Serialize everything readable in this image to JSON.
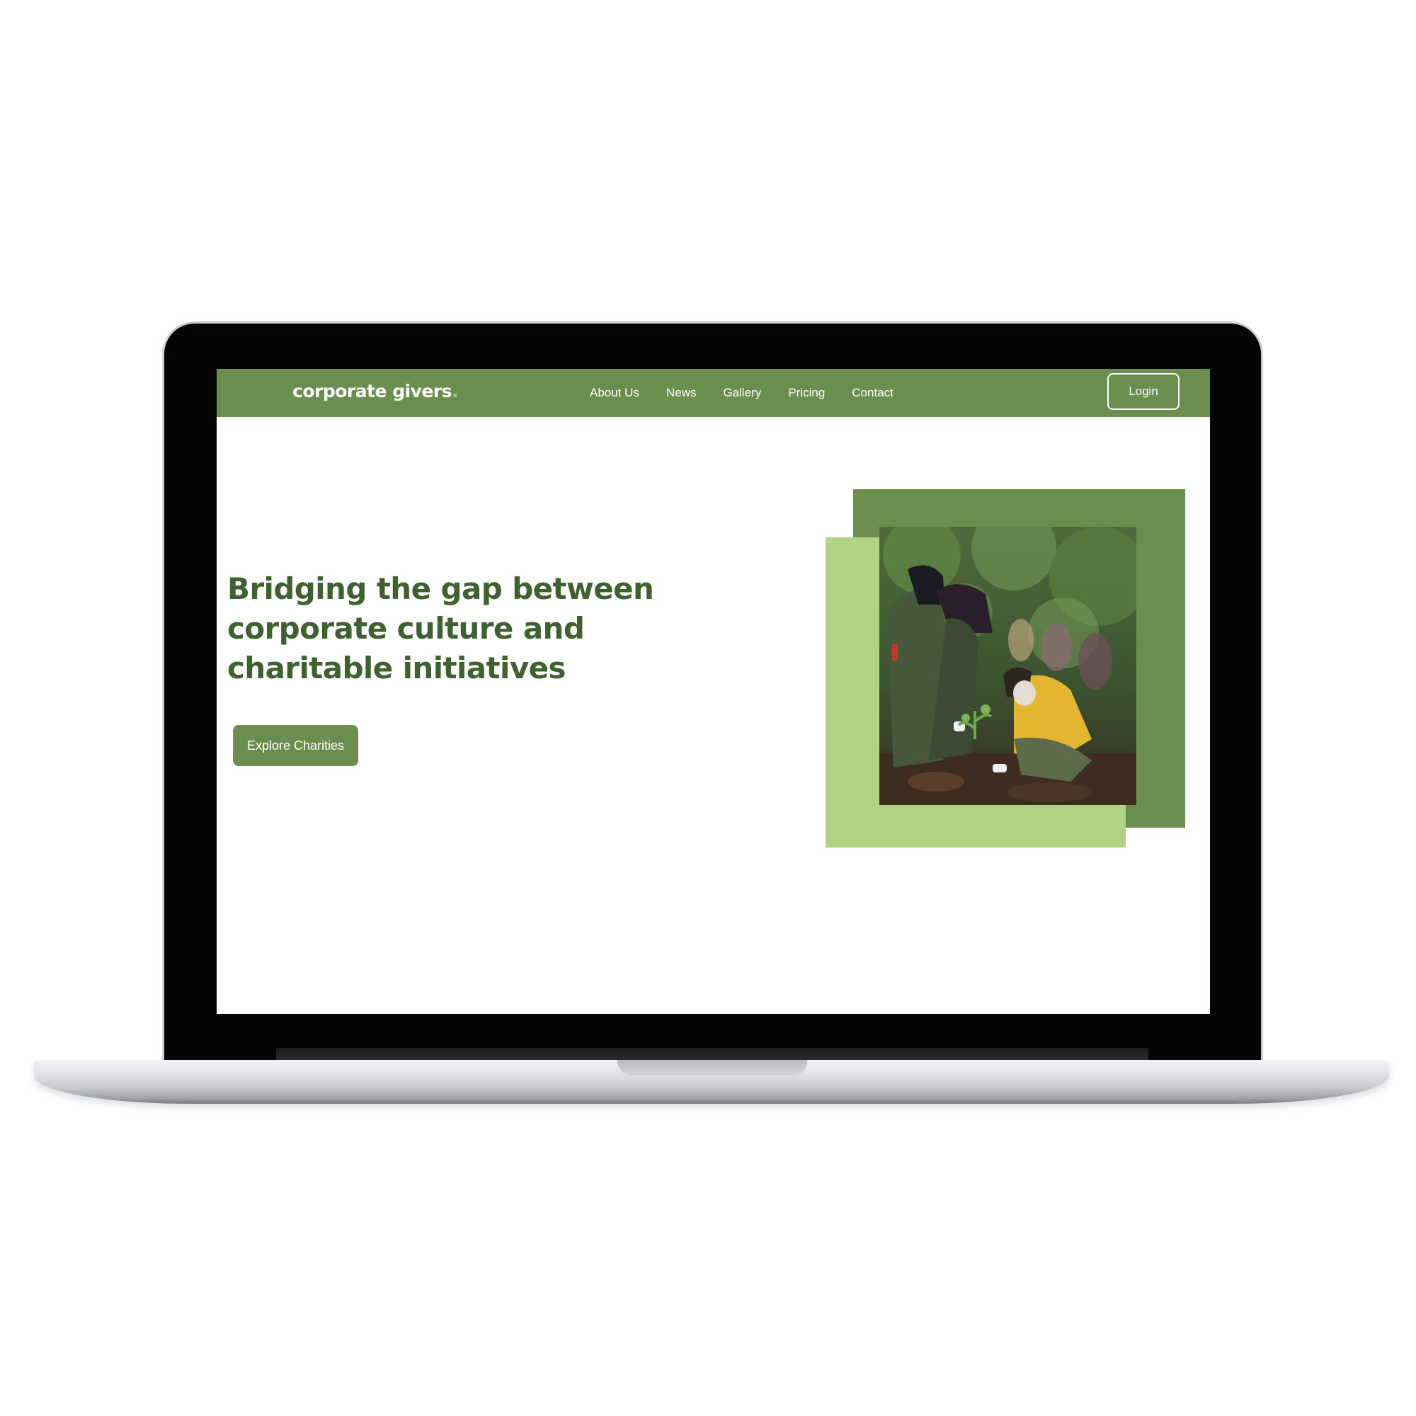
{
  "nav": {
    "brand": "corporate givers",
    "brand_dot": ".",
    "links": [
      "About Us",
      "News",
      "Gallery",
      "Pricing",
      "Contact"
    ],
    "login_label": "Login"
  },
  "hero": {
    "heading": "Bridging the gap between corporate culture and charitable initiatives",
    "cta_label": "Explore Charities"
  },
  "colors": {
    "primary_green": "#6a8e4e",
    "light_green": "#afd283",
    "heading_green": "#3f6130"
  },
  "image": {
    "subject": "volunteers planting trees"
  }
}
